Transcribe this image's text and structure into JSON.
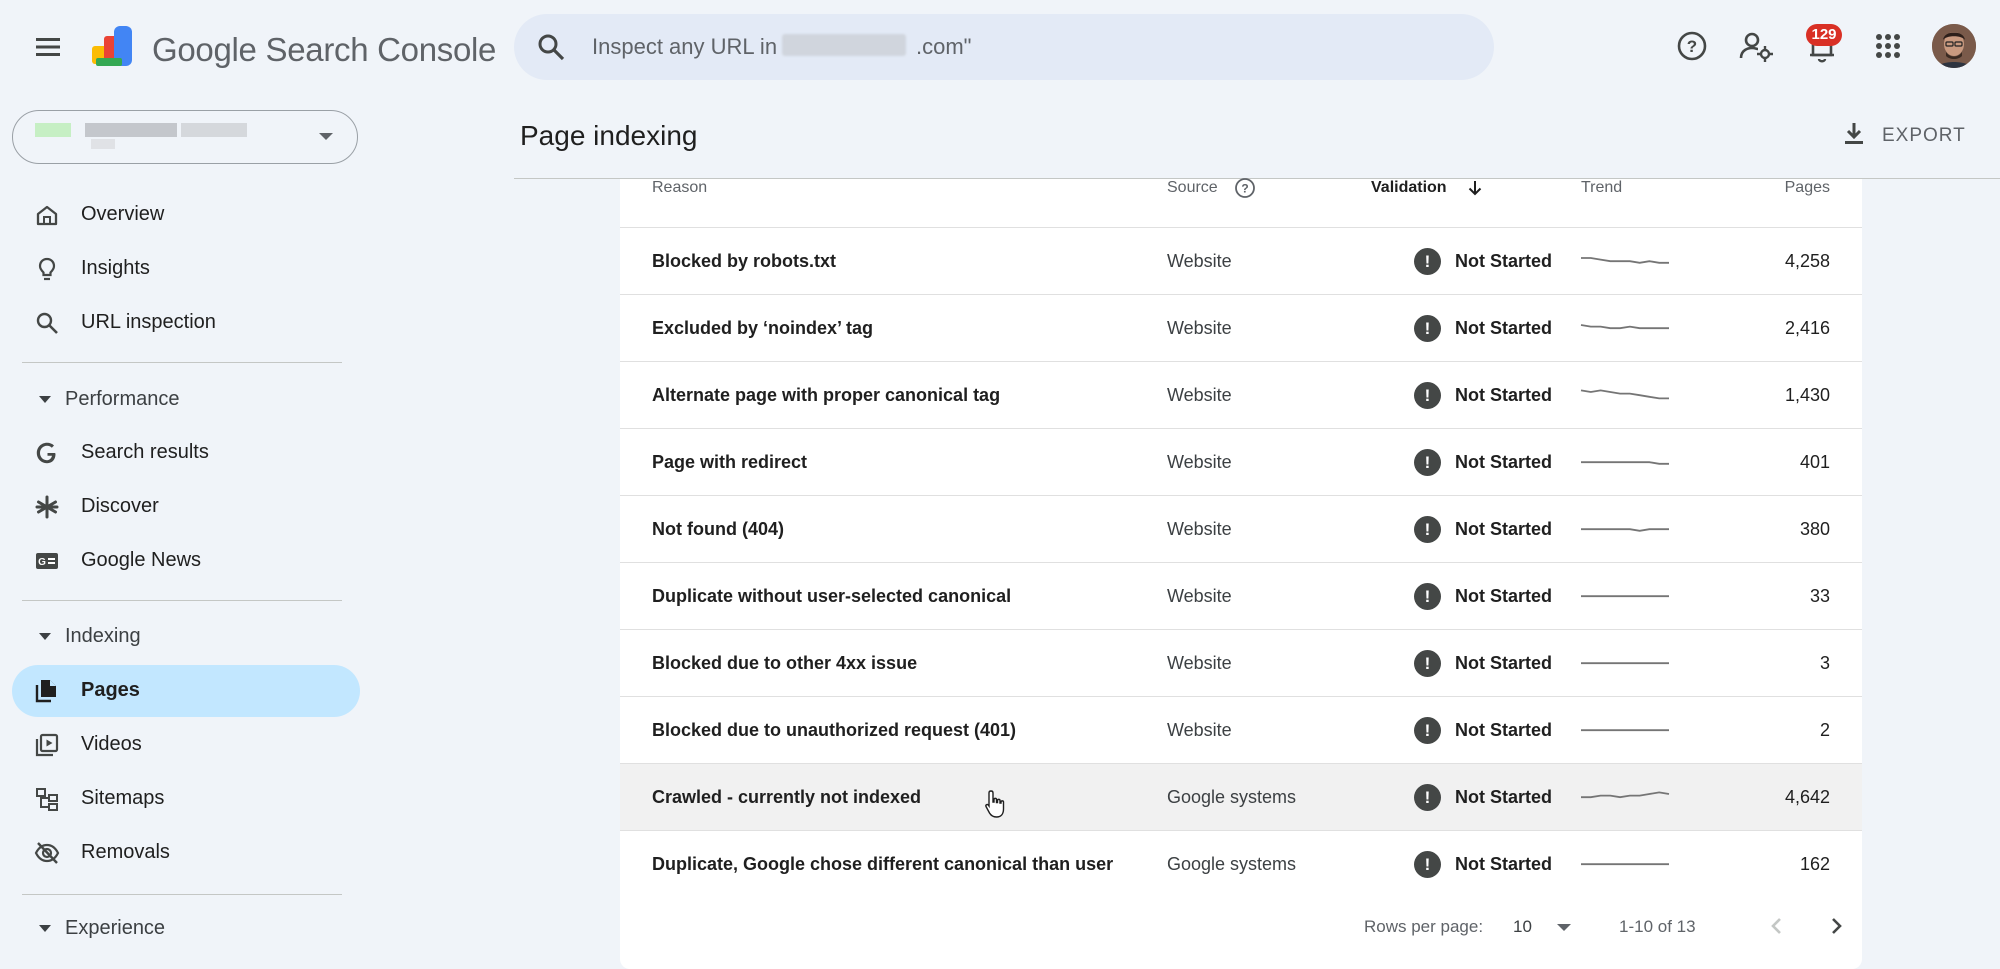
{
  "header": {
    "app_title_google": "Google",
    "app_title_product": "Search Console",
    "search_placeholder_start": "Inspect any URL in \"",
    "search_placeholder_end": ".com\"",
    "notification_count": "129",
    "icons": [
      "menu-icon",
      "search-console-logo",
      "search-icon",
      "help-icon",
      "manage-users-icon",
      "notifications-icon",
      "apps-icon",
      "avatar"
    ]
  },
  "sidebar": {
    "items_top": [
      {
        "label": "Overview",
        "icon": "home-icon"
      },
      {
        "label": "Insights",
        "icon": "lightbulb-icon"
      },
      {
        "label": "URL inspection",
        "icon": "search-icon"
      }
    ],
    "section_performance": "Performance",
    "items_performance": [
      {
        "label": "Search results",
        "icon": "google-g-icon"
      },
      {
        "label": "Discover",
        "icon": "asterisk-icon"
      },
      {
        "label": "Google News",
        "icon": "news-icon"
      }
    ],
    "section_indexing": "Indexing",
    "items_indexing": [
      {
        "label": "Pages",
        "icon": "pages-icon",
        "active": true
      },
      {
        "label": "Videos",
        "icon": "video-library-icon"
      },
      {
        "label": "Sitemaps",
        "icon": "sitemap-icon"
      },
      {
        "label": "Removals",
        "icon": "visibility-off-icon"
      }
    ],
    "section_experience": "Experience"
  },
  "main": {
    "title": "Page indexing",
    "export_label": "EXPORT"
  },
  "table": {
    "columns": {
      "reason": "Reason",
      "source": "Source",
      "validation": "Validation",
      "trend": "Trend",
      "pages": "Pages"
    },
    "rows": [
      {
        "reason": "Blocked by robots.txt",
        "source": "Website",
        "validation": "Not Started",
        "pages": "4,258",
        "trend": [
          10,
          10,
          11,
          12,
          12,
          12,
          13,
          12,
          13,
          13
        ]
      },
      {
        "reason": "Excluded by ‘noindex’ tag",
        "source": "Website",
        "validation": "Not Started",
        "pages": "2,416",
        "trend": [
          10,
          11,
          11,
          12,
          12,
          11,
          12,
          12,
          12,
          12
        ]
      },
      {
        "reason": "Alternate page with proper canonical tag",
        "source": "Website",
        "validation": "Not Started",
        "pages": "1,430",
        "trend": [
          9,
          10,
          9,
          10,
          11,
          11,
          12,
          13,
          14,
          14
        ]
      },
      {
        "reason": "Page with redirect",
        "source": "Website",
        "validation": "Not Started",
        "pages": "401",
        "trend": [
          12,
          12,
          12,
          12,
          12,
          12,
          12,
          12,
          13,
          13
        ]
      },
      {
        "reason": "Not found (404)",
        "source": "Website",
        "validation": "Not Started",
        "pages": "380",
        "trend": [
          12,
          12,
          12,
          12,
          12,
          12,
          13,
          12,
          12,
          12
        ]
      },
      {
        "reason": "Duplicate without user-selected canonical",
        "source": "Website",
        "validation": "Not Started",
        "pages": "33",
        "trend": [
          12,
          12,
          12,
          12,
          12,
          12,
          12,
          12,
          12,
          12
        ]
      },
      {
        "reason": "Blocked due to other 4xx issue",
        "source": "Website",
        "validation": "Not Started",
        "pages": "3",
        "trend": [
          12,
          12,
          12,
          12,
          12,
          12,
          12,
          12,
          12,
          12
        ]
      },
      {
        "reason": "Blocked due to unauthorized request (401)",
        "source": "Website",
        "validation": "Not Started",
        "pages": "2",
        "trend": [
          12,
          12,
          12,
          12,
          12,
          12,
          12,
          12,
          12,
          12
        ]
      },
      {
        "reason": "Crawled - currently not indexed",
        "source": "Google systems",
        "validation": "Not Started",
        "pages": "4,642",
        "trend": [
          12,
          12,
          11,
          11,
          12,
          11,
          11,
          10,
          9,
          10
        ]
      },
      {
        "reason": "Duplicate, Google chose different canonical than user",
        "source": "Google systems",
        "validation": "Not Started",
        "pages": "162",
        "trend": [
          12,
          12,
          12,
          12,
          12,
          12,
          12,
          12,
          12,
          12
        ]
      }
    ],
    "hovered_row": 8
  },
  "pagination": {
    "rows_per_page_label": "Rows per page:",
    "rows_per_page_value": "10",
    "range": "1-10 of 13"
  }
}
